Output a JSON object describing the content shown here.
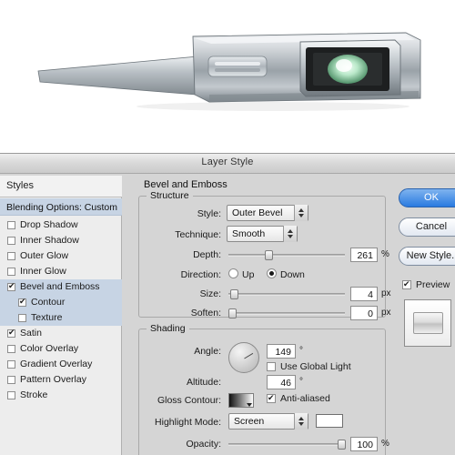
{
  "window": {
    "title": "Layer Style"
  },
  "preview": {
    "alt_name": "metallic-object-render",
    "colors": {
      "body_light": "#e9ecef",
      "body_mid": "#a9b0b6",
      "body_dark": "#6f777d",
      "screen_dark": "#1c1c1c",
      "screen_glow": "#bfeccf"
    }
  },
  "styles_panel": {
    "header": "Styles",
    "blending_options": "Blending Options: Custom",
    "items": [
      {
        "label": "Drop Shadow",
        "checked": false,
        "sub": false,
        "selected": false
      },
      {
        "label": "Inner Shadow",
        "checked": false,
        "sub": false,
        "selected": false
      },
      {
        "label": "Outer Glow",
        "checked": false,
        "sub": false,
        "selected": false
      },
      {
        "label": "Inner Glow",
        "checked": false,
        "sub": false,
        "selected": false
      },
      {
        "label": "Bevel and Emboss",
        "checked": true,
        "sub": false,
        "selected": true
      },
      {
        "label": "Contour",
        "checked": true,
        "sub": true,
        "selected": true
      },
      {
        "label": "Texture",
        "checked": false,
        "sub": true,
        "selected": true
      },
      {
        "label": "Satin",
        "checked": true,
        "sub": false,
        "selected": false
      },
      {
        "label": "Color Overlay",
        "checked": false,
        "sub": false,
        "selected": false
      },
      {
        "label": "Gradient Overlay",
        "checked": false,
        "sub": false,
        "selected": false
      },
      {
        "label": "Pattern Overlay",
        "checked": false,
        "sub": false,
        "selected": false
      },
      {
        "label": "Stroke",
        "checked": false,
        "sub": false,
        "selected": false
      }
    ]
  },
  "main": {
    "title": "Bevel and Emboss",
    "structure": {
      "legend": "Structure",
      "style_label": "Style:",
      "style_value": "Outer Bevel",
      "technique_label": "Technique:",
      "technique_value": "Smooth",
      "depth_label": "Depth:",
      "depth_value": "261",
      "depth_unit": "%",
      "direction_label": "Direction:",
      "direction_up": "Up",
      "direction_down": "Down",
      "size_label": "Size:",
      "size_value": "4",
      "size_unit": "px",
      "soften_label": "Soften:",
      "soften_value": "0",
      "soften_unit": "px"
    },
    "shading": {
      "legend": "Shading",
      "angle_label": "Angle:",
      "angle_value": "149",
      "angle_unit": "°",
      "use_global_light": "Use Global Light",
      "altitude_label": "Altitude:",
      "altitude_value": "46",
      "altitude_unit": "°",
      "gloss_contour_label": "Gloss Contour:",
      "anti_aliased": "Anti-aliased",
      "highlight_mode_label": "Highlight Mode:",
      "highlight_mode_value": "Screen",
      "opacity_label": "Opacity:",
      "opacity_value": "100",
      "opacity_unit": "%"
    }
  },
  "buttons": {
    "ok": "OK",
    "cancel": "Cancel",
    "new_style": "New Style...",
    "preview": "Preview"
  }
}
